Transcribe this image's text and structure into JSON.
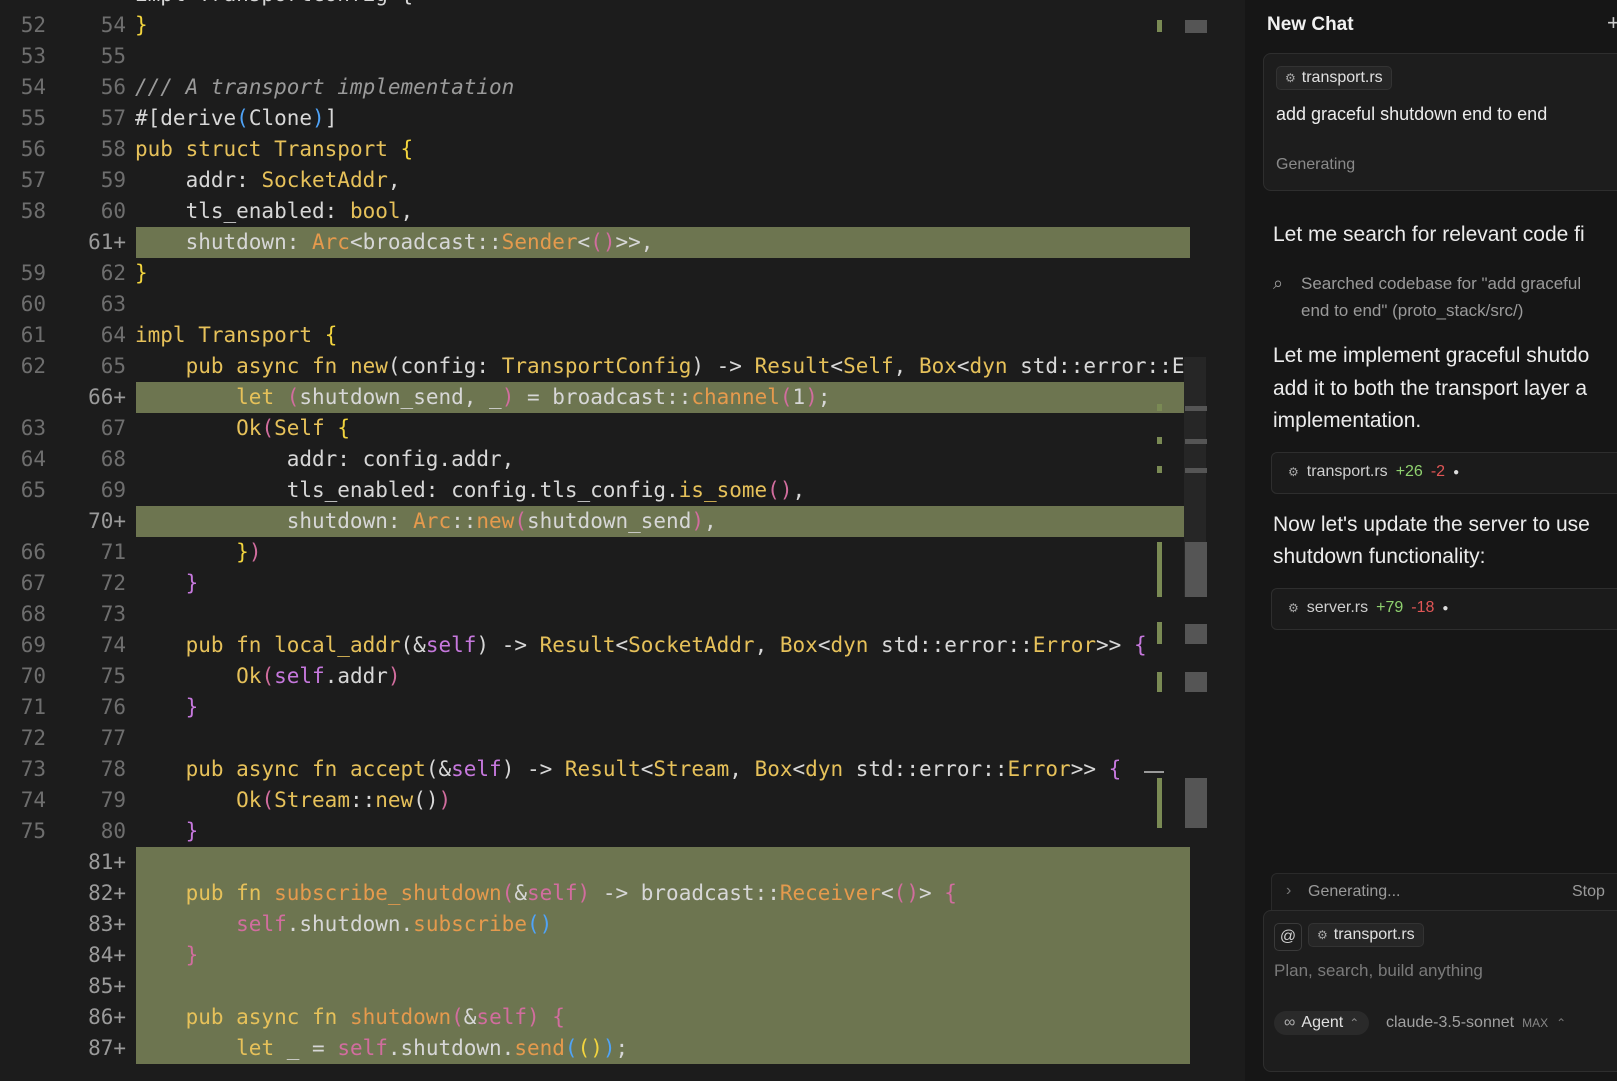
{
  "editor": {
    "top_partial": {
      "old": "",
      "new": "",
      "code": "impl TransportConfig {"
    },
    "lines": [
      {
        "old": "52",
        "new": "54",
        "added": false,
        "html": "<span class='b'>}</span>"
      },
      {
        "old": "53",
        "new": "55",
        "added": false,
        "html": ""
      },
      {
        "old": "54",
        "new": "56",
        "added": false,
        "html": "<span class='c'>/// A transport implementation</span>"
      },
      {
        "old": "55",
        "new": "57",
        "added": false,
        "html": "#[derive<span class='pn'>(</span>Clone<span class='pn'>)</span>]"
      },
      {
        "old": "56",
        "new": "58",
        "added": false,
        "html": "<span class='kw'>pub struct</span> <span class='t'>Transport</span> <span class='b'>{</span>"
      },
      {
        "old": "57",
        "new": "59",
        "added": false,
        "html": "    addr: <span class='t'>SocketAddr</span>,"
      },
      {
        "old": "58",
        "new": "60",
        "added": false,
        "html": "    tls_enabled: <span class='t'>bool</span>,"
      },
      {
        "old": "",
        "new": "61+",
        "added": true,
        "html": "    shutdown: <span class='or'>Arc</span>&lt;broadcast::<span class='or'>Sender</span>&lt;<span class='pr'>()</span>&gt;&gt;,"
      },
      {
        "old": "59",
        "new": "62",
        "added": false,
        "html": "<span class='b'>}</span>"
      },
      {
        "old": "60",
        "new": "63",
        "added": false,
        "html": ""
      },
      {
        "old": "61",
        "new": "64",
        "added": false,
        "html": "<span class='kw'>impl</span> <span class='t'>Transport</span> <span class='b'>{</span>"
      },
      {
        "old": "62",
        "new": "65",
        "added": false,
        "html": "    <span class='kw'>pub async fn</span> <span class='f'>new</span>(config: <span class='t'>TransportConfig</span>) -&gt; <span class='t'>Result</span>&lt;<span class='t'>Self</span>, <span class='t'>Box</span>&lt;<span class='kw'>dyn</span> std::error::Er"
      },
      {
        "old": "",
        "new": "66+",
        "added": true,
        "html": "        <span class='kw'>let</span> <span class='pr'>(</span>shutdown_send, _<span class='pr'>)</span> = broadcast::<span class='or'>channel</span><span class='pr'>(</span>1<span class='pr'>)</span>;"
      },
      {
        "old": "63",
        "new": "67",
        "added": false,
        "html": "        <span class='t'>Ok</span><span class='pr'>(</span><span class='t'>Self</span> <span class='b'>{</span>"
      },
      {
        "old": "64",
        "new": "68",
        "added": false,
        "html": "            addr: config.addr,"
      },
      {
        "old": "65",
        "new": "69",
        "added": false,
        "html": "            tls_enabled: config.tls_config.<span class='f'>is_some</span><span class='pr'>()</span>,"
      },
      {
        "old": "",
        "new": "70+",
        "added": true,
        "html": "            shutdown: <span class='or'>Arc</span>::<span class='or'>new</span><span class='pr'>(</span>shutdown_send<span class='pr'>)</span>,"
      },
      {
        "old": "66",
        "new": "71",
        "added": false,
        "html": "        <span class='b'>}</span><span class='pr'>)</span>"
      },
      {
        "old": "67",
        "new": "72",
        "added": false,
        "html": "    <span class='pb'>}</span>"
      },
      {
        "old": "68",
        "new": "73",
        "added": false,
        "html": ""
      },
      {
        "old": "69",
        "new": "74",
        "added": false,
        "html": "    <span class='kw'>pub fn</span> <span class='f'>local_addr</span>(&amp;<span class='sf'>self</span>) -&gt; <span class='t'>Result</span>&lt;<span class='t'>SocketAddr</span>, <span class='t'>Box</span>&lt;<span class='kw'>dyn</span> std::error::<span class='t'>Error</span>&gt;&gt; <span class='pb'>{</span>"
      },
      {
        "old": "70",
        "new": "75",
        "added": false,
        "html": "        <span class='t'>Ok</span><span class='pr'>(</span><span class='sf'>self</span>.addr<span class='pr'>)</span>"
      },
      {
        "old": "71",
        "new": "76",
        "added": false,
        "html": "    <span class='pb'>}</span>"
      },
      {
        "old": "72",
        "new": "77",
        "added": false,
        "html": ""
      },
      {
        "old": "73",
        "new": "78",
        "added": false,
        "html": "    <span class='kw'>pub async fn</span> <span class='f'>accept</span>(&amp;<span class='sf'>self</span>) -&gt; <span class='t'>Result</span>&lt;<span class='t'>Stream</span>, <span class='t'>Box</span>&lt;<span class='kw'>dyn</span> std::error::<span class='t'>Error</span>&gt;&gt; <span class='pb'>{</span>"
      },
      {
        "old": "74",
        "new": "79",
        "added": false,
        "html": "        <span class='t'>Ok</span><span class='pr'>(</span><span class='t'>Stream</span>::<span class='f'>new</span>()<span class='pr'>)</span>"
      },
      {
        "old": "75",
        "new": "80",
        "added": false,
        "html": "    <span class='pb'>}</span>"
      },
      {
        "old": "",
        "new": "81+",
        "added": true,
        "html": ""
      },
      {
        "old": "",
        "new": "82+",
        "added": true,
        "html": "    <span class='kw'>pub fn</span> <span class='or'>subscribe_shutdown</span><span class='pr'>(</span>&amp;<span class='pr'>self)</span> -&gt; broadcast::<span class='or'>Receiver</span>&lt;<span class='pr'>()</span>&gt; <span class='pr'>{</span>"
      },
      {
        "old": "",
        "new": "83+",
        "added": true,
        "html": "        <span class='pr'>self</span>.shutdown.<span class='or'>subscribe</span><span class='pn'>()</span>"
      },
      {
        "old": "",
        "new": "84+",
        "added": true,
        "html": "    <span class='pr'>}</span>"
      },
      {
        "old": "",
        "new": "85+",
        "added": true,
        "html": ""
      },
      {
        "old": "",
        "new": "86+",
        "added": true,
        "html": "    <span class='kw'>pub async fn</span> <span class='or'>shutdown</span><span class='pr'>(</span>&amp;<span class='pr'>self)</span> <span class='pr'>{</span>"
      },
      {
        "old": "",
        "new": "87+",
        "added": true,
        "html": "        <span class='kw'>let</span> _ = <span class='pr'>self</span>.shutdown.<span class='or'>send</span><span class='pn'>(</span><span class='b'>()</span><span class='pn'>)</span>;"
      }
    ]
  },
  "chat": {
    "title": "New Chat",
    "plus": "+",
    "request": {
      "file": "transport.rs",
      "text": "add graceful shutdown end to end",
      "status": "Generating"
    },
    "messages": {
      "m1": "Let me search for relevant code fi",
      "search_line1": "Searched codebase for \"add graceful",
      "search_line2": "end to end\" (proto_stack/src/)",
      "m2_l1": "Let me implement graceful shutdo",
      "m2_l2": "add it to both the transport layer a",
      "m2_l3": "implementation.",
      "m3_l1": "Now let's update the server to use",
      "m3_l2": "shutdown functionality:"
    },
    "diffs": [
      {
        "file": "transport.rs",
        "plus": "+26",
        "minus": "-2"
      },
      {
        "file": "server.rs",
        "plus": "+79",
        "minus": "-18"
      }
    ],
    "generating_bar": {
      "label": "Generating...",
      "stop": "Stop"
    },
    "composer": {
      "at": "@",
      "file": "transport.rs",
      "placeholder": "Plan, search, build anything",
      "mode": "Agent",
      "model": "claude-3.5-sonnet",
      "model_badge": "MAX"
    }
  }
}
